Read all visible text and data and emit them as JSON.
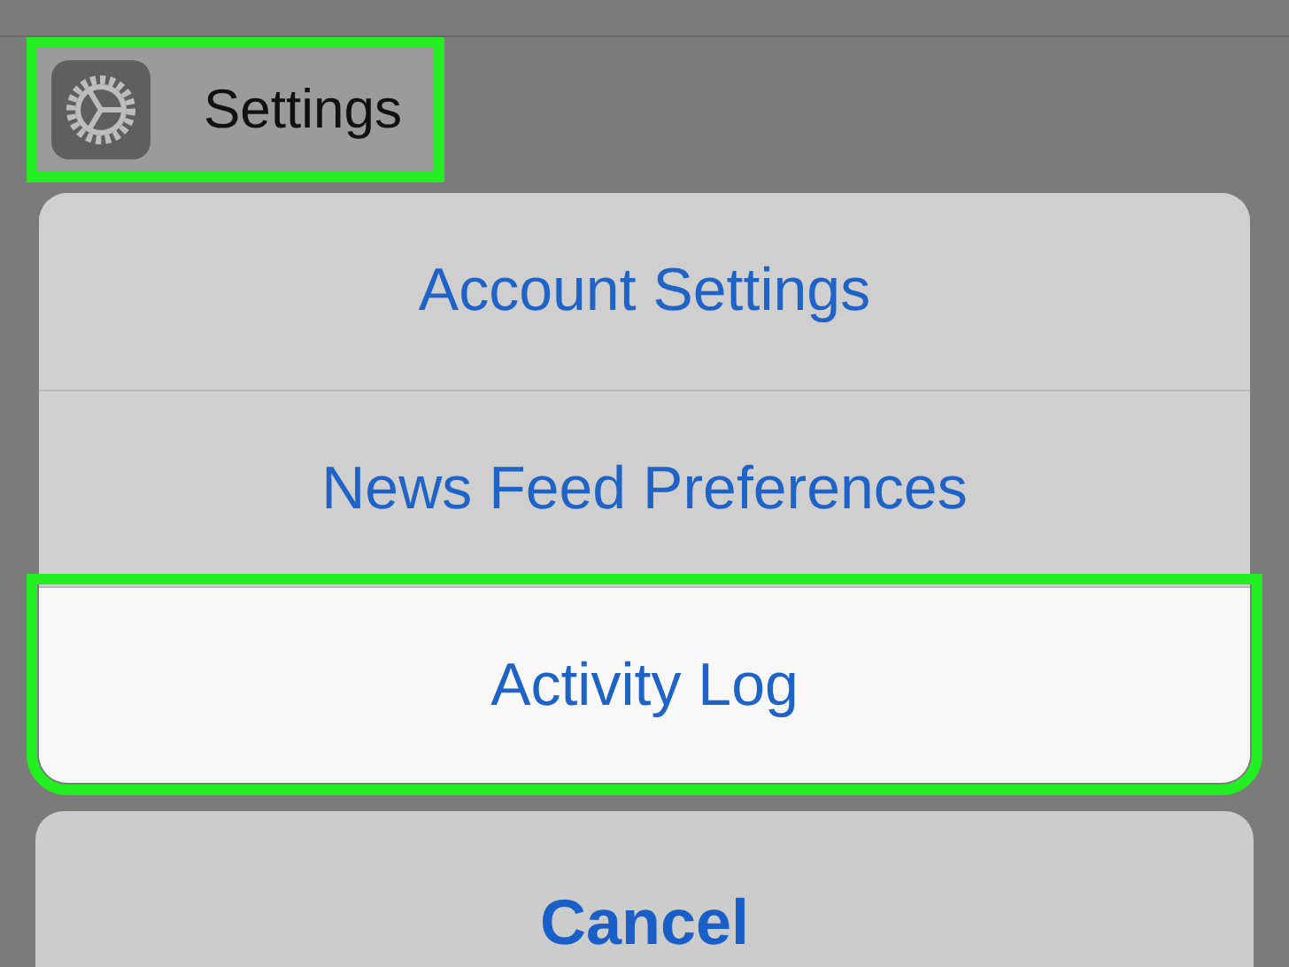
{
  "settings_row": {
    "label": "Settings",
    "highlighted": true
  },
  "action_sheet": {
    "items": [
      {
        "label": "Account Settings",
        "selected": false
      },
      {
        "label": "News Feed Preferences",
        "selected": false
      },
      {
        "label": "Activity Log",
        "selected": true
      }
    ]
  },
  "cancel_button": {
    "label": "Cancel"
  }
}
